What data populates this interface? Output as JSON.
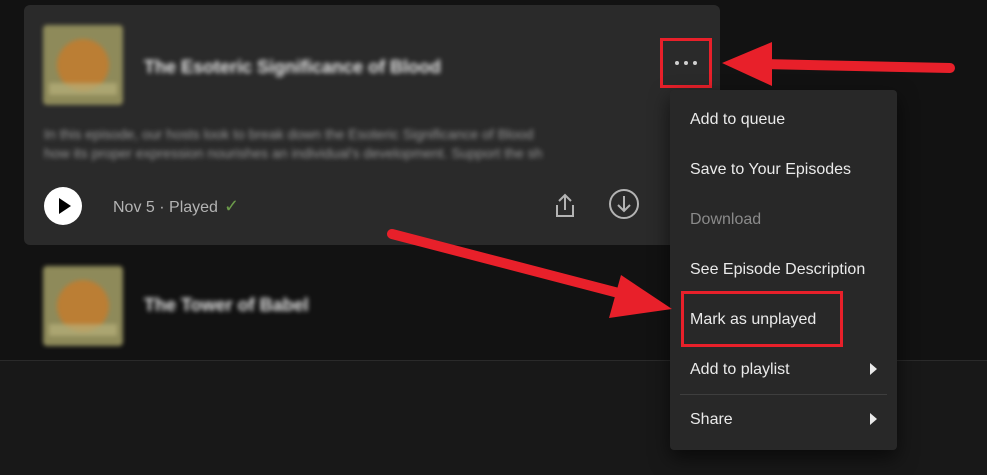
{
  "episode1": {
    "title": "The Esoteric Significance of Blood",
    "description_line1": "In this episode, our hosts look to break down the Esoteric Significance of Blood",
    "description_line2": "how its proper expression nourishes an individual's development. Support the sh",
    "date_status": "Nov 5 · Played",
    "check_glyph": "✓"
  },
  "episode2": {
    "title": "The Tower of Babel"
  },
  "context_menu": {
    "items": [
      {
        "label": "Add to queue",
        "disabled": false,
        "submenu": false
      },
      {
        "label": "Save to Your Episodes",
        "disabled": false,
        "submenu": false
      },
      {
        "label": "Download",
        "disabled": true,
        "submenu": false
      },
      {
        "label": "See Episode Description",
        "disabled": false,
        "submenu": false
      },
      {
        "label": "Mark as unplayed",
        "disabled": false,
        "submenu": false
      },
      {
        "label": "Add to playlist",
        "disabled": false,
        "submenu": true
      },
      {
        "label": "Share",
        "disabled": false,
        "submenu": true
      }
    ]
  },
  "icons": {
    "play": "play-icon",
    "share": "share-icon",
    "download": "download-circle-icon",
    "more": "more-horizontal-icon"
  },
  "colors": {
    "annotation_red": "#e8202a",
    "played_check": "#6b9a4a",
    "menu_bg": "#282828",
    "card_bg": "#2a2a2a"
  }
}
